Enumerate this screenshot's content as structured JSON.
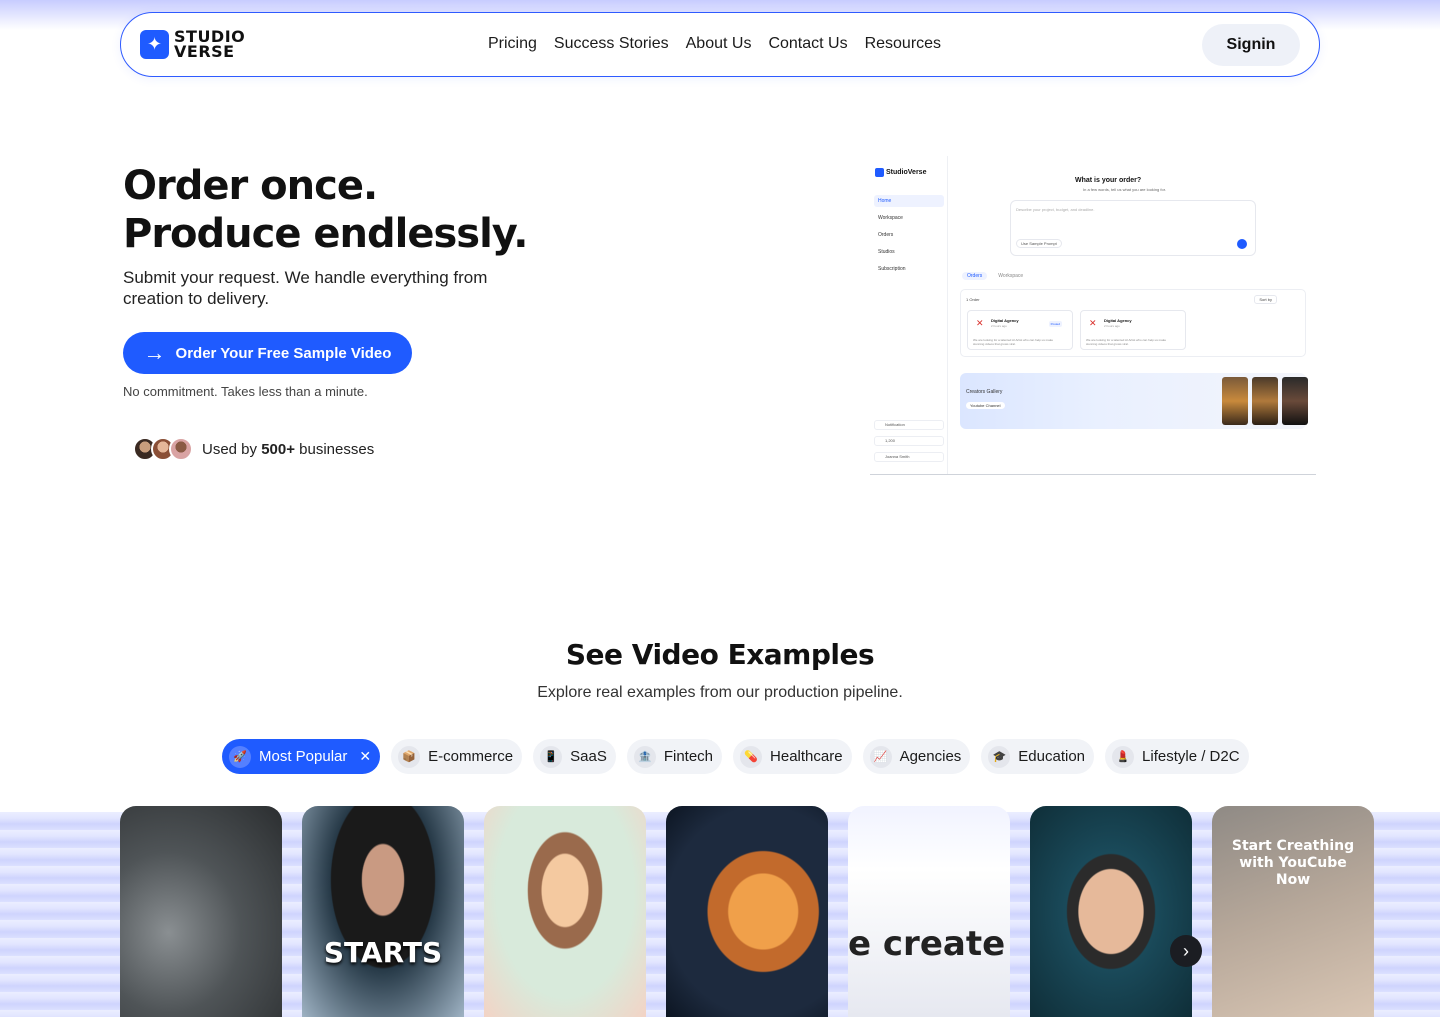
{
  "brand": {
    "logo_line1": "STUDIO",
    "logo_line2": "VERSE"
  },
  "nav": {
    "links": [
      "Pricing",
      "Success Stories",
      "About Us",
      "Contact Us",
      "Resources"
    ],
    "signin_label": "Signin"
  },
  "hero": {
    "title_line1": "Order once.",
    "title_line2": "Produce endlessly.",
    "subtitle": "Submit your request. We handle everything from creation to delivery.",
    "cta_label": "Order Your Free Sample Video",
    "note": "No commitment. Takes less than a minute.",
    "used_by_prefix": "Used by ",
    "used_by_count": "500+",
    "used_by_suffix": " businesses"
  },
  "dashboard": {
    "app_name": "StudioVerse",
    "menu": [
      "Home",
      "Workspace",
      "Orders",
      "Studios",
      "Subscription"
    ],
    "footer_items": [
      "Notification",
      "1,200",
      "Joanna Smith"
    ],
    "question": "What is your order?",
    "question_sub": "In a few words, tell us what you are looking for.",
    "input_placeholder": "Describe your project, budget, and deadline.",
    "sample_prompt": "Use Sample Prompt",
    "tabs": [
      "Orders",
      "Workspace"
    ],
    "orders_label": "1 Order",
    "sort_label": "Sort by",
    "cards": [
      {
        "title": "Digital Agency",
        "time": "2 hours ago",
        "badge": "Posted",
        "desc": "We are looking for a talented AI Artist who can help us make stunning videos that grows viral."
      },
      {
        "title": "Digital Agency",
        "time": "2 hours ago",
        "badge": "",
        "desc": "We are looking for a talented AI Artist who can help us make stunning videos that grows viral."
      }
    ],
    "gallery_title": "Creators Gallery",
    "gallery_button": "Youtube Channel"
  },
  "examples": {
    "title": "See Video Examples",
    "subtitle": "Explore real examples from our production pipeline.",
    "chips": [
      {
        "label": "Most Popular",
        "icon": "rocket-icon",
        "active": true
      },
      {
        "label": "E-commerce",
        "icon": "package-icon",
        "active": false
      },
      {
        "label": "SaaS",
        "icon": "phone-icon",
        "active": false
      },
      {
        "label": "Fintech",
        "icon": "bank-icon",
        "active": false
      },
      {
        "label": "Healthcare",
        "icon": "pill-icon",
        "active": false
      },
      {
        "label": "Agencies",
        "icon": "chart-icon",
        "active": false
      },
      {
        "label": "Education",
        "icon": "graduation-cap-icon",
        "active": false
      },
      {
        "label": "Lifestyle / D2C",
        "icon": "lipstick-icon",
        "active": false
      }
    ],
    "card_overlays": [
      "STARTS",
      "e create b",
      "Start Creathing with YouCube Now"
    ]
  },
  "colors": {
    "accent": "#1f5bff",
    "chip_bg": "#f1f3f7",
    "text": "#111111"
  }
}
